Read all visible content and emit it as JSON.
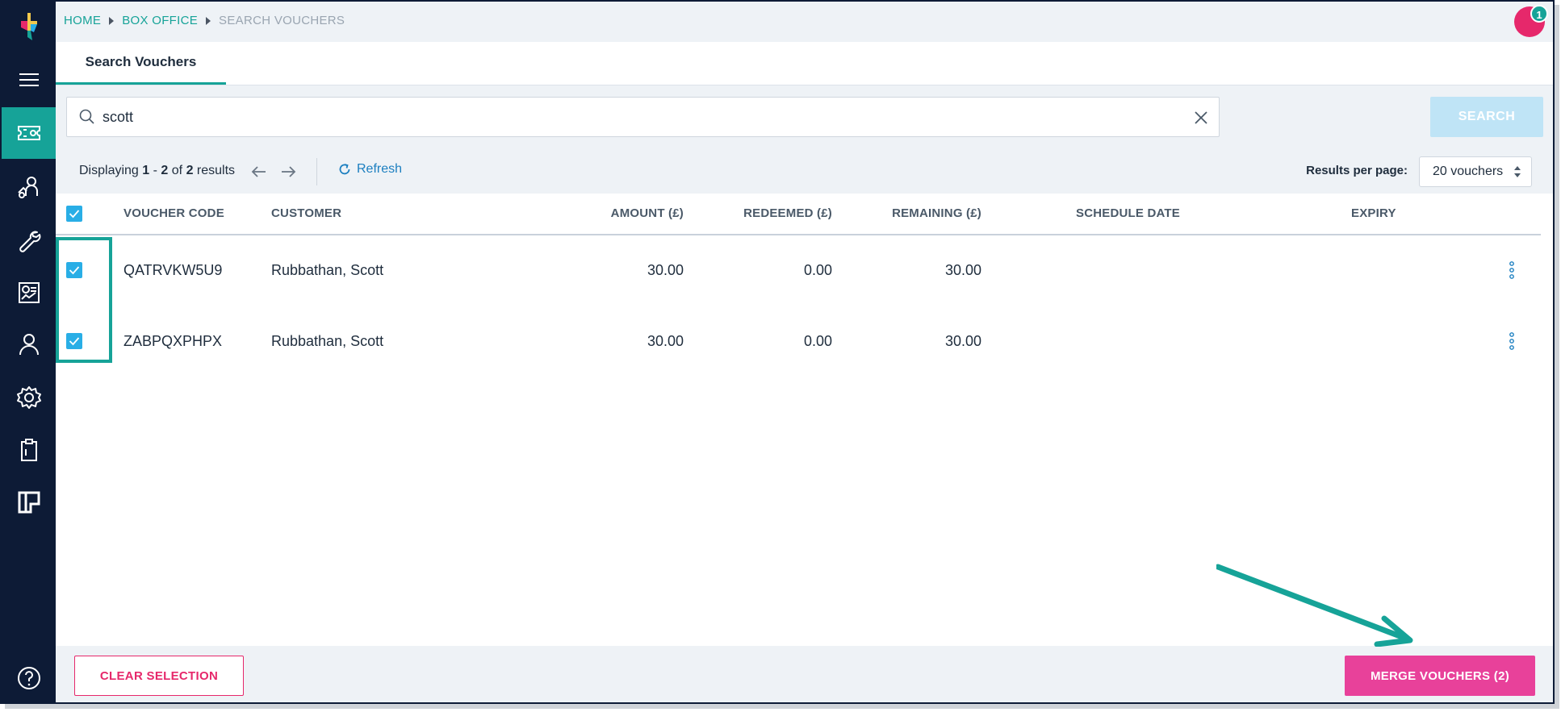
{
  "breadcrumb": {
    "home": "HOME",
    "box_office": "BOX OFFICE",
    "current": "SEARCH VOUCHERS"
  },
  "notifications": {
    "count": "1"
  },
  "tabs": [
    {
      "label": "Search Vouchers"
    }
  ],
  "search": {
    "value": "scott",
    "button_label": "SEARCH"
  },
  "results": {
    "prefix": "Displaying",
    "range_start": "1",
    "dash": "-",
    "range_end": "2",
    "of": "of",
    "total": "2",
    "suffix": "results",
    "refresh_label": "Refresh",
    "per_page_label": "Results per page:",
    "per_page_value": "20 vouchers"
  },
  "table": {
    "columns": {
      "code": "VOUCHER CODE",
      "customer": "CUSTOMER",
      "amount": "AMOUNT (£)",
      "redeemed": "REDEEMED (£)",
      "remaining": "REMAINING (£)",
      "schedule": "SCHEDULE DATE",
      "expiry": "EXPIRY"
    },
    "rows": [
      {
        "code": "QATRVKW5U9",
        "customer": "Rubbathan, Scott",
        "amount": "30.00",
        "redeemed": "0.00",
        "remaining": "30.00",
        "schedule": "",
        "expiry": "",
        "selected": true
      },
      {
        "code": "ZABPQXPHPX",
        "customer": "Rubbathan, Scott",
        "amount": "30.00",
        "redeemed": "0.00",
        "remaining": "30.00",
        "schedule": "",
        "expiry": "",
        "selected": true
      }
    ]
  },
  "footer": {
    "clear_label": "CLEAR SELECTION",
    "merge_label": "MERGE VOUCHERS (2)"
  },
  "colors": {
    "sidebar": "#0d1b36",
    "accent": "#16a398",
    "pink": "#e8419a",
    "checkbox": "#29aee6"
  },
  "sidebar_icons": [
    "menu-icon",
    "ticket-icon",
    "user-plus-icon",
    "wrench-icon",
    "chart-icon",
    "user-icon",
    "gear-icon",
    "clipboard-icon",
    "layout-icon",
    "help-icon"
  ]
}
